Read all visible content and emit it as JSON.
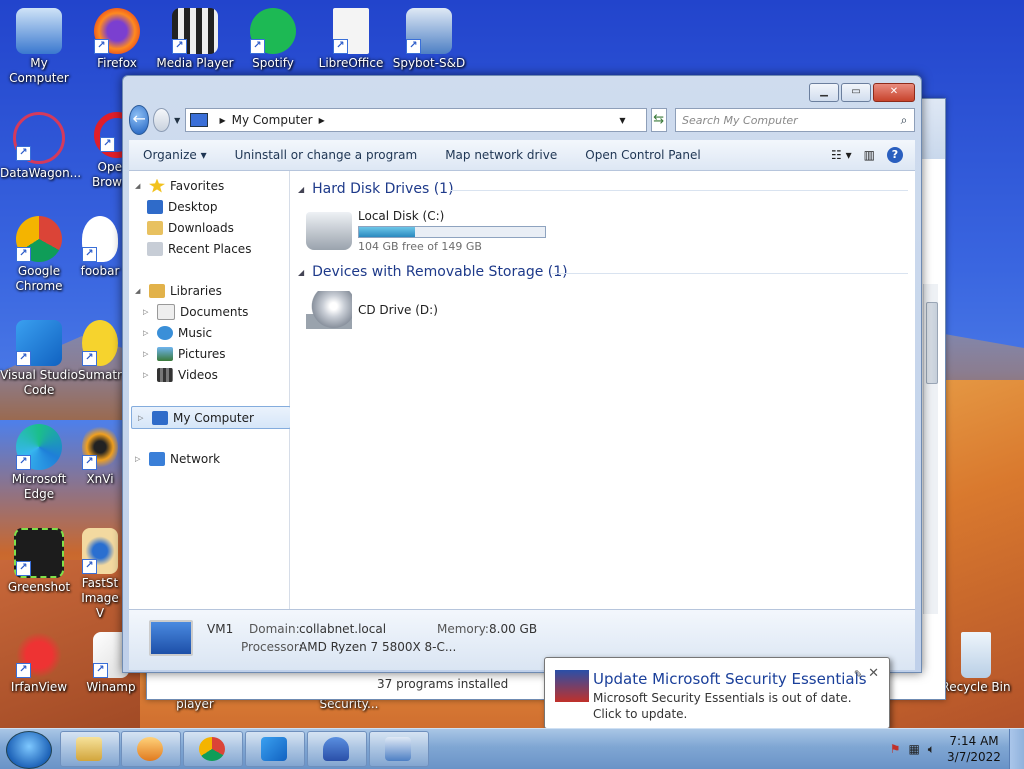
{
  "desktop": {
    "icons": [
      {
        "label": "My Computer"
      },
      {
        "label": "Firefox"
      },
      {
        "label": "Media Player"
      },
      {
        "label": "Spotify"
      },
      {
        "label": "LibreOffice"
      },
      {
        "label": "Spybot-S&D"
      },
      {
        "label": "DataWagon..."
      },
      {
        "label": "Ope Brow"
      },
      {
        "label": "Google Chrome"
      },
      {
        "label": "foobar"
      },
      {
        "label": "Visual Studio Code"
      },
      {
        "label": "Sumatr"
      },
      {
        "label": "Microsoft Edge"
      },
      {
        "label": "XnVi"
      },
      {
        "label": "Greenshot"
      },
      {
        "label": "FastSt Image V"
      },
      {
        "label": "IrfanView"
      },
      {
        "label": "Winamp"
      },
      {
        "label": "Recycle Bin"
      }
    ],
    "partial_labels": [
      "player",
      "Security..."
    ]
  },
  "window": {
    "address": {
      "location": "My Computer"
    },
    "search_placeholder": "Search My Computer",
    "toolbar": {
      "organize": "Organize",
      "uninstall": "Uninstall or change a program",
      "map_drive": "Map network drive",
      "control_panel": "Open Control Panel"
    },
    "nav": {
      "favorites": "Favorites",
      "desktop": "Desktop",
      "downloads": "Downloads",
      "recent": "Recent Places",
      "libraries": "Libraries",
      "documents": "Documents",
      "music": "Music",
      "pictures": "Pictures",
      "videos": "Videos",
      "my_computer": "My Computer",
      "network": "Network"
    },
    "groups": {
      "hdd": "Hard Disk Drives (1)",
      "removable": "Devices with Removable Storage (1)"
    },
    "drives": {
      "c_name": "Local Disk (C:)",
      "c_free": "104 GB free of 149 GB",
      "c_used_fraction": 0.302,
      "d_name": "CD Drive (D:)"
    },
    "details": {
      "name": "VM1",
      "domain_label": "Domain:",
      "domain": "collabnet.local",
      "memory_label": "Memory:",
      "memory": "8.00 GB",
      "processor_label": "Processor:",
      "processor": "AMD Ryzen 7 5800X 8-C..."
    }
  },
  "back_window": {
    "footer": "37 programs installed"
  },
  "notification": {
    "title": "Update Microsoft Security Essentials",
    "body": "Microsoft Security Essentials is out of date. Click to update."
  },
  "taskbar": {
    "time": "7:14 AM",
    "date": "3/7/2022"
  },
  "colors": {
    "accent": "#1e3a8a",
    "taskbar": "#7fa6d3",
    "disk_fill": "#2a89bf"
  }
}
